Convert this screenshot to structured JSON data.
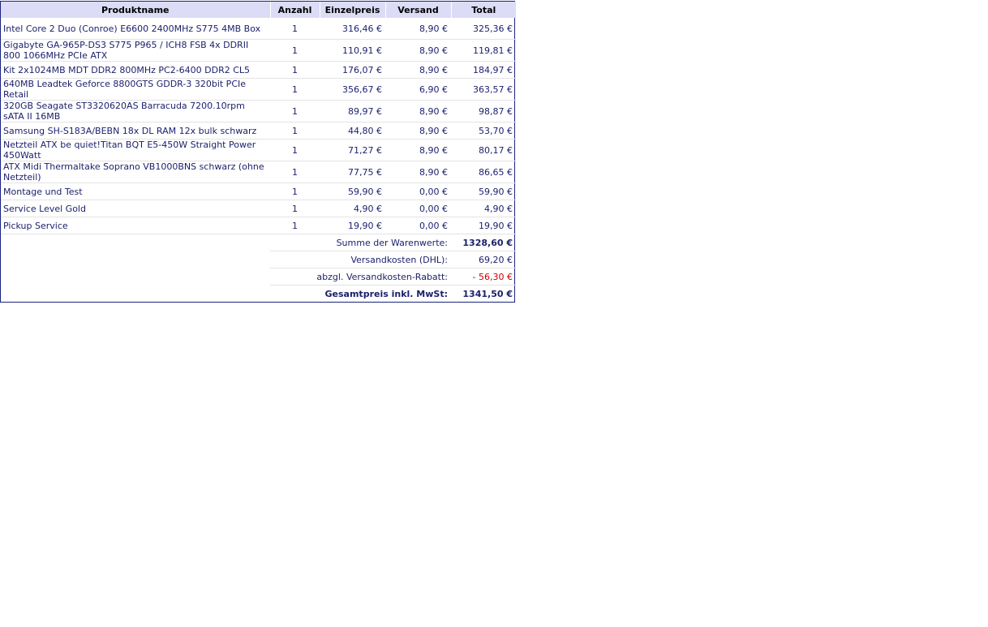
{
  "header": {
    "col_name": "Produktname",
    "col_qty": "Anzahl",
    "col_unit": "Einzelpreis",
    "col_ship": "Versand",
    "col_total": "Total"
  },
  "items": [
    {
      "name": "Intel Core 2 Duo (Conroe) E6600 2400MHz S775 4MB Box",
      "qty": "1",
      "unit": "316,46 €",
      "ship": "8,90 €",
      "total": "325,36 €"
    },
    {
      "name": "Gigabyte GA-965P-DS3 S775 P965 / ICH8 FSB 4x DDRII 800 1066MHz PCIe ATX",
      "qty": "1",
      "unit": "110,91 €",
      "ship": "8,90 €",
      "total": "119,81 €"
    },
    {
      "name": "Kit 2x1024MB MDT DDR2 800MHz PC2-6400 DDR2 CL5",
      "qty": "1",
      "unit": "176,07 €",
      "ship": "8,90 €",
      "total": "184,97 €"
    },
    {
      "name": "640MB Leadtek Geforce 8800GTS GDDR-3 320bit PCIe Retail",
      "qty": "1",
      "unit": "356,67 €",
      "ship": "6,90 €",
      "total": "363,57 €"
    },
    {
      "name": "320GB Seagate ST3320620AS Barracuda 7200.10rpm sATA II 16MB",
      "qty": "1",
      "unit": "89,97 €",
      "ship": "8,90 €",
      "total": "98,87 €"
    },
    {
      "name": "Samsung SH-S183A/BEBN 18x DL RAM 12x bulk schwarz",
      "qty": "1",
      "unit": "44,80 €",
      "ship": "8,90 €",
      "total": "53,70 €"
    },
    {
      "name": "Netzteil ATX be quiet!Titan BQT E5-450W Straight Power 450Watt",
      "qty": "1",
      "unit": "71,27 €",
      "ship": "8,90 €",
      "total": "80,17 €"
    },
    {
      "name": "ATX Midi Thermaltake Soprano VB1000BNS schwarz (ohne Netzteil)",
      "qty": "1",
      "unit": "77,75 €",
      "ship": "8,90 €",
      "total": "86,65 €"
    },
    {
      "name": "Montage und Test",
      "qty": "1",
      "unit": "59,90 €",
      "ship": "0,00 €",
      "total": "59,90 €"
    },
    {
      "name": "Service Level Gold",
      "qty": "1",
      "unit": "4,90 €",
      "ship": "0,00 €",
      "total": "4,90 €"
    },
    {
      "name": "Pickup Service",
      "qty": "1",
      "unit": "19,90 €",
      "ship": "0,00 €",
      "total": "19,90 €"
    }
  ],
  "summary": {
    "subtotal_label": "Summe der Warenwerte:",
    "subtotal_value": "1328,60 €",
    "shipping_label": "Versandkosten (DHL):",
    "shipping_value": "69,20 €",
    "discount_label": "abzgl. Versandkosten-Rabatt:",
    "discount_value": "- 56,30 €",
    "grand_label": "Gesamtpreis inkl. MwSt:",
    "grand_value": "1341,50 €"
  },
  "colors": {
    "border": "#1a237e",
    "header_bg": "#dcdcf6",
    "text": "#1a1f6b",
    "discount": "#cc0000"
  }
}
